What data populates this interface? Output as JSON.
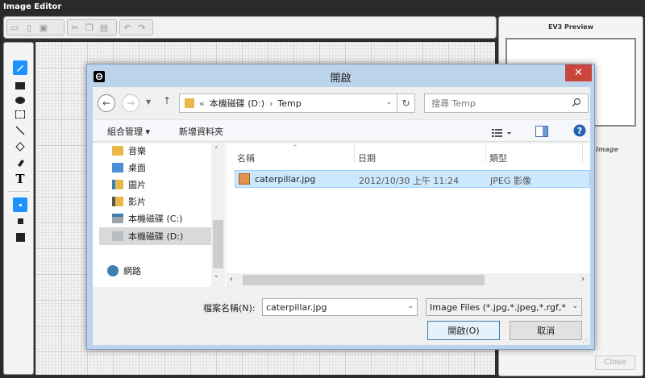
{
  "editor": {
    "title": "Image Editor",
    "preview_title": "EV3 Preview",
    "image_label": "Image",
    "close_label": "Close"
  },
  "dialog": {
    "title": "開啟",
    "close_glyph": "✕",
    "address": {
      "chevron": "«",
      "segments": [
        "本機磁碟 (D:)",
        "Temp"
      ]
    },
    "search_placeholder": "搜尋 Temp",
    "commands": {
      "organize": "組合管理 ▾",
      "new_folder": "新增資料夾"
    },
    "nav_items": [
      {
        "label": "音樂",
        "icon": "music-folder-icon"
      },
      {
        "label": "桌面",
        "icon": "desktop-folder-icon"
      },
      {
        "label": "圖片",
        "icon": "pictures-folder-icon"
      },
      {
        "label": "影片",
        "icon": "videos-folder-icon"
      },
      {
        "label": "本機磁碟 (C:)",
        "icon": "drive-c-icon"
      },
      {
        "label": "本機磁碟 (D:)",
        "icon": "drive-d-icon",
        "selected": true
      },
      {
        "label": "網路",
        "icon": "network-icon"
      }
    ],
    "columns": {
      "name": "名稱",
      "date": "日期",
      "type": "類型"
    },
    "files": [
      {
        "name": "caterpillar.jpg",
        "date": "2012/10/30 上午 11:24",
        "type": "JPEG 影像"
      }
    ],
    "filename_label": "檔案名稱(N):",
    "filename_value": "caterpillar.jpg",
    "filter_value": "Image Files (*.jpg,*.jpeg,*.rgf,*",
    "open_button": "開啟(O)",
    "cancel_button": "取消"
  },
  "colors": {
    "dialog_frame": "#bcd3ec",
    "close_red": "#c9463d",
    "selection": "#cce8ff",
    "accent_blue": "#1e90ff"
  }
}
